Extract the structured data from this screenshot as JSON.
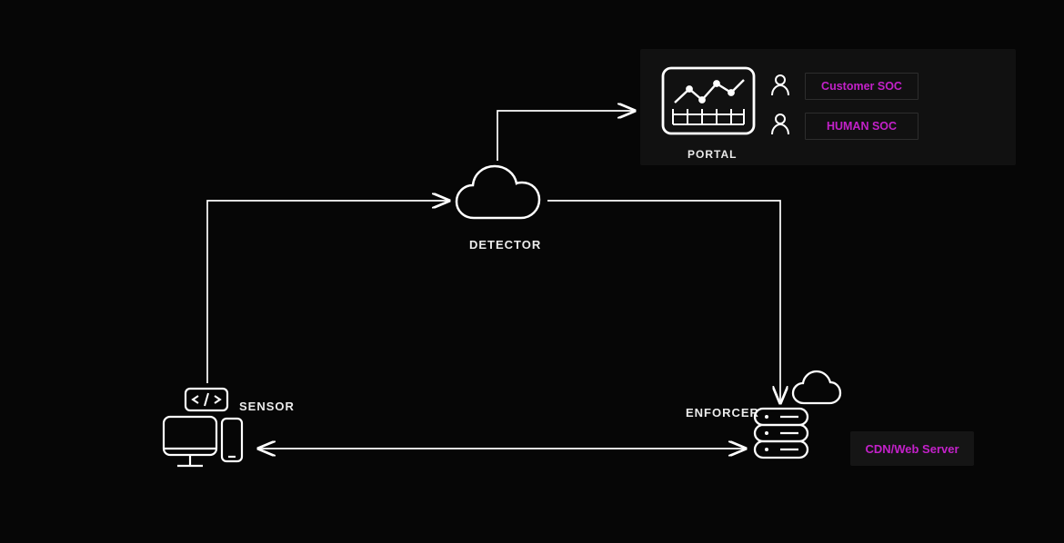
{
  "nodes": {
    "sensor": {
      "label": "SENSOR"
    },
    "detector": {
      "label": "DETECTOR"
    },
    "enforcer": {
      "label": "ENFORCER"
    },
    "portal": {
      "label": "PORTAL"
    }
  },
  "portal_panel": {
    "customer_soc": "Customer SOC",
    "human_soc": "HUMAN SOC"
  },
  "cdn_label": "CDN/Web Server",
  "connections": [
    {
      "from": "sensor",
      "to": "detector",
      "bidirectional": false
    },
    {
      "from": "detector",
      "to": "portal",
      "bidirectional": false
    },
    {
      "from": "detector",
      "to": "enforcer",
      "bidirectional": false
    },
    {
      "from": "sensor",
      "to": "enforcer",
      "bidirectional": true
    }
  ],
  "colors": {
    "line": "#ffffff",
    "accent": "#c321c9",
    "panel": "#111111",
    "bg": "#060606"
  }
}
